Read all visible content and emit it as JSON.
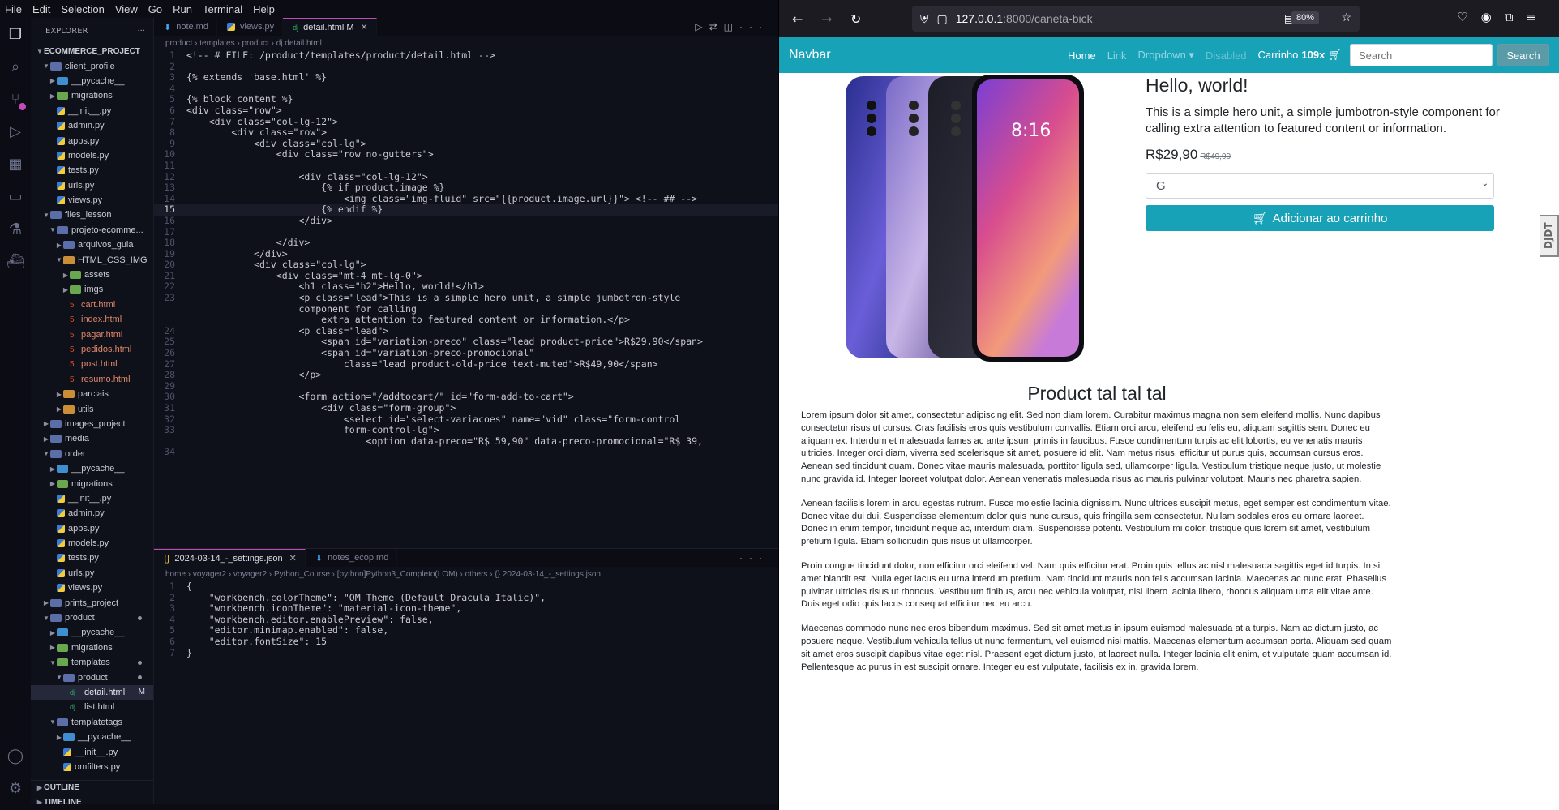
{
  "menubar": [
    "File",
    "Edit",
    "Selection",
    "View",
    "Go",
    "Run",
    "Terminal",
    "Help"
  ],
  "explorer": {
    "title": "EXPLORER",
    "project": "ECOMMERCE_PROJECT",
    "items": [
      {
        "label": "client_profile",
        "depth": 1,
        "type": "folder-open"
      },
      {
        "label": "__pycache__",
        "depth": 2,
        "type": "folder"
      },
      {
        "label": "migrations",
        "depth": 2,
        "type": "folder"
      },
      {
        "label": "__init__.py",
        "depth": 2,
        "type": "py"
      },
      {
        "label": "admin.py",
        "depth": 2,
        "type": "py"
      },
      {
        "label": "apps.py",
        "depth": 2,
        "type": "py"
      },
      {
        "label": "models.py",
        "depth": 2,
        "type": "py"
      },
      {
        "label": "tests.py",
        "depth": 2,
        "type": "py"
      },
      {
        "label": "urls.py",
        "depth": 2,
        "type": "py"
      },
      {
        "label": "views.py",
        "depth": 2,
        "type": "py"
      },
      {
        "label": "files_lesson",
        "depth": 1,
        "type": "folder-open"
      },
      {
        "label": "projeto-ecomme...",
        "depth": 2,
        "type": "folder-open"
      },
      {
        "label": "arquivos_guia",
        "depth": 3,
        "type": "folder"
      },
      {
        "label": "HTML_CSS_IMG",
        "depth": 3,
        "type": "folder-open"
      },
      {
        "label": "assets",
        "depth": 4,
        "type": "folder"
      },
      {
        "label": "imgs",
        "depth": 4,
        "type": "folder"
      },
      {
        "label": "cart.html",
        "depth": 4,
        "type": "html"
      },
      {
        "label": "index.html",
        "depth": 4,
        "type": "html"
      },
      {
        "label": "pagar.html",
        "depth": 4,
        "type": "html"
      },
      {
        "label": "pedidos.html",
        "depth": 4,
        "type": "html"
      },
      {
        "label": "post.html",
        "depth": 4,
        "type": "html"
      },
      {
        "label": "resumo.html",
        "depth": 4,
        "type": "html"
      },
      {
        "label": "parciais",
        "depth": 3,
        "type": "folder"
      },
      {
        "label": "utils",
        "depth": 3,
        "type": "folder"
      },
      {
        "label": "images_project",
        "depth": 1,
        "type": "folder"
      },
      {
        "label": "media",
        "depth": 1,
        "type": "folder"
      },
      {
        "label": "order",
        "depth": 1,
        "type": "folder-open"
      },
      {
        "label": "__pycache__",
        "depth": 2,
        "type": "folder"
      },
      {
        "label": "migrations",
        "depth": 2,
        "type": "folder"
      },
      {
        "label": "__init__.py",
        "depth": 2,
        "type": "py"
      },
      {
        "label": "admin.py",
        "depth": 2,
        "type": "py"
      },
      {
        "label": "apps.py",
        "depth": 2,
        "type": "py"
      },
      {
        "label": "models.py",
        "depth": 2,
        "type": "py"
      },
      {
        "label": "tests.py",
        "depth": 2,
        "type": "py"
      },
      {
        "label": "urls.py",
        "depth": 2,
        "type": "py"
      },
      {
        "label": "views.py",
        "depth": 2,
        "type": "py"
      },
      {
        "label": "prints_project",
        "depth": 1,
        "type": "folder"
      },
      {
        "label": "product",
        "depth": 1,
        "type": "folder-open",
        "dot": true
      },
      {
        "label": "__pycache__",
        "depth": 2,
        "type": "folder"
      },
      {
        "label": "migrations",
        "depth": 2,
        "type": "folder"
      },
      {
        "label": "templates",
        "depth": 2,
        "type": "folder-open",
        "dot": true
      },
      {
        "label": "product",
        "depth": 3,
        "type": "folder-open",
        "dot": true
      },
      {
        "label": "detail.html",
        "depth": 4,
        "type": "dj",
        "mark": "M",
        "selected": true
      },
      {
        "label": "list.html",
        "depth": 4,
        "type": "dj"
      },
      {
        "label": "templatetags",
        "depth": 2,
        "type": "folder-open"
      },
      {
        "label": "__pycache__",
        "depth": 3,
        "type": "folder"
      },
      {
        "label": "__init__.py",
        "depth": 3,
        "type": "py"
      },
      {
        "label": "omfilters.py",
        "depth": 3,
        "type": "py"
      }
    ],
    "outline": "OUTLINE",
    "timeline": "TIMELINE"
  },
  "editor": {
    "tabs": [
      {
        "label": "note.md",
        "active": false
      },
      {
        "label": "views.py",
        "active": false
      },
      {
        "label": "detail.html M",
        "active": true
      }
    ],
    "breadcrumb": "product › templates › product › dj  detail.html",
    "current_line": 15,
    "lines": [
      {
        "n": "1",
        "t": "<!-- # FILE: /product/templates/product/detail.html -->",
        "k": "cm"
      },
      {
        "n": "2",
        "t": "",
        "k": "pl"
      },
      {
        "n": "3",
        "t": "{% extends 'base.html' %}",
        "k": "dj"
      },
      {
        "n": "4",
        "t": "",
        "k": "pl"
      },
      {
        "n": "5",
        "t": "{% block content %}",
        "k": "dj"
      },
      {
        "n": "6",
        "t": "<div class=\"row\">",
        "k": "tg"
      },
      {
        "n": "7",
        "t": "    <div class=\"col-lg-12\">",
        "k": "tg"
      },
      {
        "n": "8",
        "t": "        <div class=\"row\">",
        "k": "tg"
      },
      {
        "n": "9",
        "t": "            <div class=\"col-lg\">",
        "k": "tg"
      },
      {
        "n": "10",
        "t": "                <div class=\"row no-gutters\">",
        "k": "tg"
      },
      {
        "n": "11",
        "t": "",
        "k": "pl"
      },
      {
        "n": "12",
        "t": "                    <div class=\"col-lg-12\">",
        "k": "tg"
      },
      {
        "n": "13",
        "t": "                        {% if product.image %}",
        "k": "dj"
      },
      {
        "n": "14",
        "t": "                            <img class=\"img-fluid\" src=\"{{product.image.url}}\"> <!-- ## -->",
        "k": "tg"
      },
      {
        "n": "15",
        "t": "                        {% endif %}",
        "k": "dj"
      },
      {
        "n": "16",
        "t": "                    </div>",
        "k": "tg"
      },
      {
        "n": "17",
        "t": "",
        "k": "pl"
      },
      {
        "n": "18",
        "t": "                </div>",
        "k": "tg"
      },
      {
        "n": "19",
        "t": "            </div>",
        "k": "tg"
      },
      {
        "n": "20",
        "t": "            <div class=\"col-lg\">",
        "k": "tg"
      },
      {
        "n": "21",
        "t": "                <div class=\"mt-4 mt-lg-0\">",
        "k": "tg"
      },
      {
        "n": "22",
        "t": "                    <h1 class=\"h2\">Hello, world!</h1>",
        "k": "tg"
      },
      {
        "n": "23",
        "t": "                    <p class=\"lead\">This is a simple hero unit, a simple jumbotron-style",
        "k": "tg"
      },
      {
        "n": "",
        "t": "                    component for calling",
        "k": "pl"
      },
      {
        "n": "",
        "t": "                        extra attention to featured content or information.</p>",
        "k": "pl"
      },
      {
        "n": "24",
        "t": "                    <p class=\"lead\">",
        "k": "tg"
      },
      {
        "n": "25",
        "t": "                        <span id=\"variation-preco\" class=\"lead product-price\">R$29,90</span>",
        "k": "tg"
      },
      {
        "n": "26",
        "t": "                        <span id=\"variation-preco-promocional\"",
        "k": "tg"
      },
      {
        "n": "27",
        "t": "                            class=\"lead product-old-price text-muted\">R$49,90</span>",
        "k": "tg"
      },
      {
        "n": "28",
        "t": "                    </p>",
        "k": "tg"
      },
      {
        "n": "29",
        "t": "",
        "k": "pl"
      },
      {
        "n": "30",
        "t": "                    <form action=\"/addtocart/\" id=\"form-add-to-cart\">",
        "k": "tg"
      },
      {
        "n": "31",
        "t": "                        <div class=\"form-group\">",
        "k": "tg"
      },
      {
        "n": "32",
        "t": "                            <select id=\"select-variacoes\" name=\"vid\" class=\"form-control",
        "k": "tg"
      },
      {
        "n": "33",
        "t": "                            form-control-lg\">",
        "k": "pl"
      },
      {
        "n": "",
        "t": "                                <option data-preco=\"R$ 59,90\" data-preco-promocional=\"R$ 39,",
        "k": "tg"
      },
      {
        "n": "34",
        "t": "",
        "k": "pl"
      }
    ]
  },
  "editor2": {
    "tabs": [
      {
        "label": "2024-03-14_-_settings.json",
        "active": true
      },
      {
        "label": "notes_ecop.md",
        "active": false
      }
    ],
    "breadcrumb": "home › voyager2 › voyager2 › Python_Course › [python]Python3_Completo(LOM) › others › {} 2024-03-14_-_settings.json",
    "lines": [
      {
        "n": "1",
        "t": "{"
      },
      {
        "n": "2",
        "t": "    \"workbench.colorTheme\": \"OM Theme (Default Dracula Italic)\","
      },
      {
        "n": "3",
        "t": "    \"workbench.iconTheme\": \"material-icon-theme\","
      },
      {
        "n": "4",
        "t": "    \"workbench.editor.enablePreview\": false,"
      },
      {
        "n": "5",
        "t": "    \"editor.minimap.enabled\": false,"
      },
      {
        "n": "6",
        "t": "    \"editor.fontSize\": 15"
      },
      {
        "n": "7",
        "t": "}"
      }
    ]
  },
  "browser": {
    "url_host": "127.0.0.1",
    "url_path": ":8000/caneta-bick",
    "zoom": "80%",
    "navbar": {
      "brand": "Navbar",
      "home": "Home",
      "link": "Link",
      "dropdown": "Dropdown ▾",
      "disabled": "Disabled",
      "cart_label": "Carrinho",
      "cart_count": "109x",
      "search_placeholder": "Search",
      "search_button": "Search"
    },
    "hero": {
      "title": "Hello, world!",
      "lead": "This is a simple hero unit, a simple jumbotron-style component for calling extra attention to featured content or information.",
      "price": "R$29,90",
      "old_price": "R$49,90",
      "variation": "G",
      "add_button": "Adicionar ao carrinho"
    },
    "djdt": "DJDT",
    "product_title": "Product tal tal tal",
    "paragraphs": [
      "Lorem ipsum dolor sit amet, consectetur adipiscing elit. Sed non diam lorem. Curabitur maximus magna non sem eleifend mollis. Nunc dapibus consectetur risus ut cursus. Cras facilisis eros quis vestibulum convallis. Etiam orci arcu, eleifend eu felis eu, aliquam sagittis sem. Donec eu aliquam ex. Interdum et malesuada fames ac ante ipsum primis in faucibus. Fusce condimentum turpis ac elit lobortis, eu venenatis mauris ultricies. Integer orci diam, viverra sed scelerisque sit amet, posuere id elit. Nam metus risus, efficitur ut purus quis, accumsan cursus eros. Aenean sed tincidunt quam. Donec vitae mauris malesuada, porttitor ligula sed, ullamcorper ligula. Vestibulum tristique neque justo, ut molestie nunc gravida id. Integer laoreet volutpat dolor. Aenean venenatis malesuada risus ac mauris pulvinar volutpat. Mauris nec pharetra sapien.",
      "Aenean facilisis lorem in arcu egestas rutrum. Fusce molestie lacinia dignissim. Nunc ultrices suscipit metus, eget semper est condimentum vitae. Donec vitae dui dui. Suspendisse elementum dolor quis nunc cursus, quis fringilla sem consectetur. Nullam sodales eros eu ornare laoreet. Donec in enim tempor, tincidunt neque ac, interdum diam. Suspendisse potenti. Vestibulum mi dolor, tristique quis lorem sit amet, vestibulum pretium ligula. Etiam sollicitudin quis risus ut ullamcorper.",
      "Proin congue tincidunt dolor, non efficitur orci eleifend vel. Nam quis efficitur erat. Proin quis tellus ac nisl malesuada sagittis eget id turpis. In sit amet blandit est. Nulla eget lacus eu urna interdum pretium. Nam tincidunt mauris non felis accumsan lacinia. Maecenas ac nunc erat. Phasellus pulvinar ultricies risus ut rhoncus. Vestibulum finibus, arcu nec vehicula volutpat, nisi libero lacinia libero, rhoncus aliquam urna elit vitae ante. Duis eget odio quis lacus consequat efficitur nec eu arcu.",
      "Maecenas commodo nunc nec eros bibendum maximus. Sed sit amet metus in ipsum euismod malesuada at a turpis. Nam ac dictum justo, ac posuere neque. Vestibulum vehicula tellus ut nunc fermentum, vel euismod nisi mattis. Maecenas elementum accumsan porta. Aliquam sed quam sit amet eros suscipit dapibus vitae eget nisl. Praesent eget dictum justo, at laoreet nulla. Integer lacinia elit enim, et vulputate quam accumsan id. Pellentesque ac purus in est suscipit ornare. Integer eu est vulputate, facilisis ex in, gravida lorem."
    ]
  }
}
